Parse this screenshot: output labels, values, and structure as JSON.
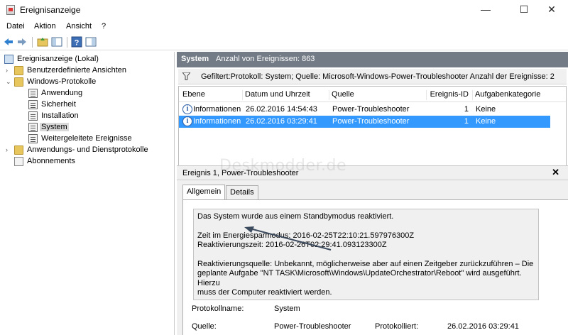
{
  "window": {
    "title": "Ereignisanzeige",
    "controls": [
      "—",
      "☐",
      "✕"
    ]
  },
  "menu": [
    "Datei",
    "Aktion",
    "Ansicht",
    "?"
  ],
  "toolbar": {
    "icons": [
      "back-arrow-icon",
      "forward-arrow-icon",
      "up-folder-icon",
      "show-hide-tree-icon",
      "help-icon",
      "properties-panel-icon"
    ]
  },
  "tree": {
    "root": "Ereignisanzeige (Lokal)",
    "custom_views": "Benutzerdefinierte Ansichten",
    "windows_logs": "Windows-Protokolle",
    "logs": [
      "Anwendung",
      "Sicherheit",
      "Installation",
      "System",
      "Weitergeleitete Ereignisse"
    ],
    "app_logs": "Anwendungs- und Dienstprotokolle",
    "subscriptions": "Abonnements",
    "selected": "System"
  },
  "panel": {
    "log_name": "System",
    "event_count": "Anzahl von Ereignissen: 863"
  },
  "filter": {
    "text": "Gefiltert:Protokoll: System; Quelle: Microsoft-Windows-Power-Troubleshooter Anzahl der Ereignisse: 2"
  },
  "grid": {
    "columns": [
      "Ebene",
      "Datum und Uhrzeit",
      "Quelle",
      "Ereignis-ID",
      "Aufgabenkategorie"
    ],
    "rows": [
      {
        "level": "Informationen",
        "datetime": "26.02.2016 14:54:43",
        "source": "Power-Troubleshooter",
        "id": "1",
        "category": "Keine"
      },
      {
        "level": "Informationen",
        "datetime": "26.02.2016 03:29:41",
        "source": "Power-Troubleshooter",
        "id": "1",
        "category": "Keine"
      }
    ],
    "selected_row": 1
  },
  "watermark": "Deskmodder.de",
  "detail": {
    "title": "Ereignis 1, Power-Troubleshooter",
    "close": "✕",
    "tabs": [
      "Allgemein",
      "Details"
    ],
    "message": {
      "line1": "Das System wurde aus einem Standbymodus reaktiviert.",
      "line2": "Zeit im Energiesparmodus: 2016-02-25T22:10:21.597976300Z",
      "line3": "Reaktivierungszeit: 2016-02-26T02:29:41.093123300Z",
      "line4": "Reaktivierungsquelle: Unbekannt, möglicherweise aber auf einen Zeitgeber zurückzuführen – Die",
      "line5": "geplante Aufgabe \"NT TASK\\Microsoft\\Windows\\UpdateOrchestrator\\Reboot\" wird ausgeführt. Hierzu",
      "line6": "muss der Computer reaktiviert werden."
    },
    "props": {
      "protocol_label": "Protokollname:",
      "protocol_value": "System",
      "source_label": "Quelle:",
      "source_value": "Power-Troubleshooter",
      "logged_label": "Protokolliert:",
      "logged_value": "26.02.2016 03:29:41"
    }
  }
}
